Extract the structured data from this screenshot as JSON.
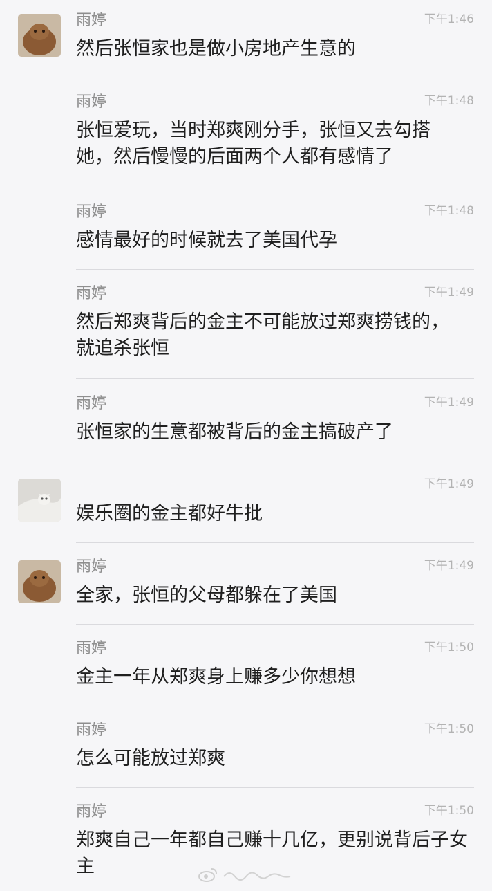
{
  "messages": [
    {
      "sender": "雨婷",
      "time": "下午1:46",
      "text": "然后张恒家也是做小房地产生意的",
      "avatar": "dog-avatar"
    },
    {
      "sender": "雨婷",
      "time": "下午1:48",
      "text": "张恒爱玩，当时郑爽刚分手，张恒又去勾搭她，然后慢慢的后面两个人都有感情了"
    },
    {
      "sender": "雨婷",
      "time": "下午1:48",
      "text": "感情最好的时候就去了美国代孕"
    },
    {
      "sender": "雨婷",
      "time": "下午1:49",
      "text": "然后郑爽背后的金主不可能放过郑爽捞钱的，就追杀张恒"
    },
    {
      "sender": "雨婷",
      "time": "下午1:49",
      "text": "张恒家的生意都被背后的金主搞破产了"
    },
    {
      "sender": "",
      "time": "下午1:49",
      "text": "娱乐圈的金主都好牛批",
      "avatar": "cat-avatar"
    },
    {
      "sender": "雨婷",
      "time": "下午1:49",
      "text": "全家，张恒的父母都躲在了美国",
      "avatar": "dog-avatar"
    },
    {
      "sender": "雨婷",
      "time": "下午1:50",
      "text": "金主一年从郑爽身上赚多少你想想"
    },
    {
      "sender": "雨婷",
      "time": "下午1:50",
      "text": "怎么可能放过郑爽"
    },
    {
      "sender": "雨婷",
      "time": "下午1:50",
      "text": "郑爽自己一年都自己赚十几亿，更别说背后子女主"
    }
  ],
  "colors": {
    "background": "#f6f6f8",
    "text": "#1f1f1f",
    "sender": "#8e8e8e",
    "time": "#b3b3b3"
  }
}
